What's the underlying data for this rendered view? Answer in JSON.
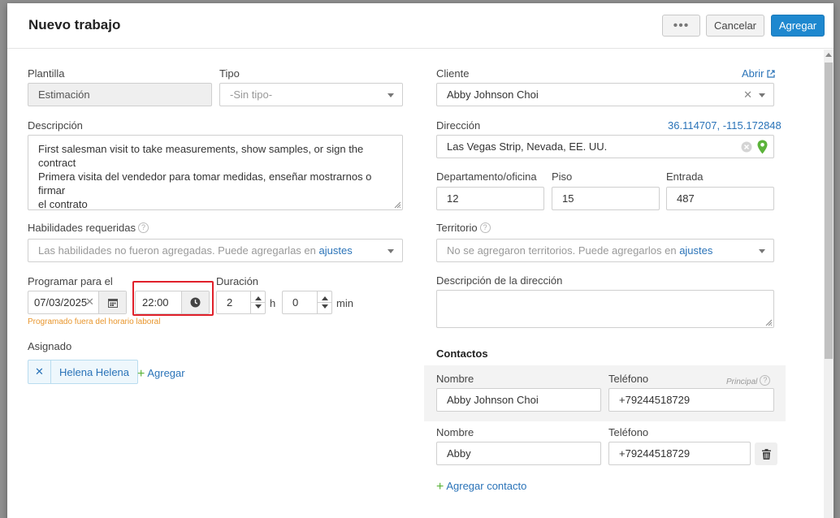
{
  "header": {
    "title": "Nuevo trabajo",
    "more_label": "•••",
    "cancel_label": "Cancelar",
    "add_label": "Agregar"
  },
  "left": {
    "template_label": "Plantilla",
    "template_value": "Estimación",
    "type_label": "Tipo",
    "type_value": "-Sin tipo-",
    "description_label": "Descripción",
    "description_line1": "First salesman visit to take measurements, show samples, or sign the contract",
    "description_line2": "Primera visita del vendedor para tomar medidas, enseñar mostrarnos o firmar",
    "description_line3": "el contrato",
    "skills_label": "Habilidades requeridas",
    "skills_placeholder": "Las habilidades no fueron agregadas. Puede agregarlas en ",
    "skills_link": "ajustes",
    "schedule_label": "Programar para el",
    "date_value": "07/03/2025",
    "time_value": "22:00",
    "duration_label": "Duración",
    "duration_hours": "2",
    "hours_unit": "h",
    "duration_minutes": "0",
    "minutes_unit": "min",
    "schedule_warning": "Programado fuera del horario laboral",
    "assigned_label": "Asignado",
    "assignee": "Helena Helena",
    "add_assignee": "Agregar"
  },
  "right": {
    "client_label": "Cliente",
    "open_link": "Abrir",
    "client_value": "Abby Johnson Choi",
    "address_label": "Dirección",
    "coordinates": "36.114707, -115.172848",
    "address_value": "Las Vegas Strip, Nevada, EE. UU.",
    "apartment_label": "Departamento/oficina",
    "apartment_value": "12",
    "floor_label": "Piso",
    "floor_value": "15",
    "entrance_label": "Entrada",
    "entrance_value": "487",
    "territory_label": "Territorio",
    "territory_placeholder": "No se agregaron territorios. Puede agregarlos en ",
    "territory_link": "ajustes",
    "address_desc_label": "Descripción de la dirección",
    "contacts_title": "Contactos",
    "contacts": [
      {
        "name_label": "Nombre",
        "name": "Abby Johnson Choi",
        "phone_label": "Teléfono",
        "phone": "+79244518729",
        "principal": "Principal"
      },
      {
        "name_label": "Nombre",
        "name": "Abby",
        "phone_label": "Teléfono",
        "phone": "+79244518729"
      }
    ],
    "add_contact": "Agregar contacto"
  },
  "colors": {
    "accent": "#1e88cf",
    "link": "#2a73b8",
    "warning": "#e8962d",
    "highlight": "#e0202a",
    "pin": "#5bb33a"
  }
}
